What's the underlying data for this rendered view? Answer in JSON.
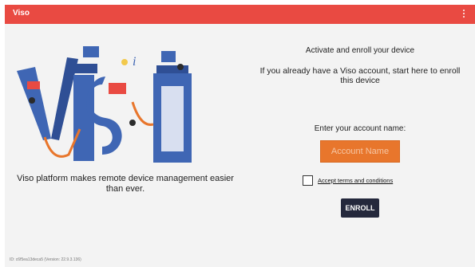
{
  "appbar": {
    "title": "Viso",
    "menu_icon": "more-vert-icon"
  },
  "illustration": {
    "word": "Viso"
  },
  "tagline": "Viso platform makes remote device management easier than ever.",
  "enroll_form": {
    "heading": "Activate and enroll your device",
    "instructions": "If you already have a Viso account, start here to enroll this device",
    "account_label": "Enter your account name:",
    "account_placeholder": "Account Name",
    "account_value": "",
    "terms_label": "Accept terms and conditions",
    "terms_checked": false,
    "enroll_button": "ENROLL"
  },
  "footer": {
    "version_text": "ID: c6f5ea13deca5 (Version: 22.9.3.136)"
  },
  "colors": {
    "appbar": "#e94a42",
    "account_input": "#e8762c",
    "enroll_button": "#24283c",
    "illustration_blue": "#3f66b4",
    "illustration_orange": "#e8762c"
  }
}
